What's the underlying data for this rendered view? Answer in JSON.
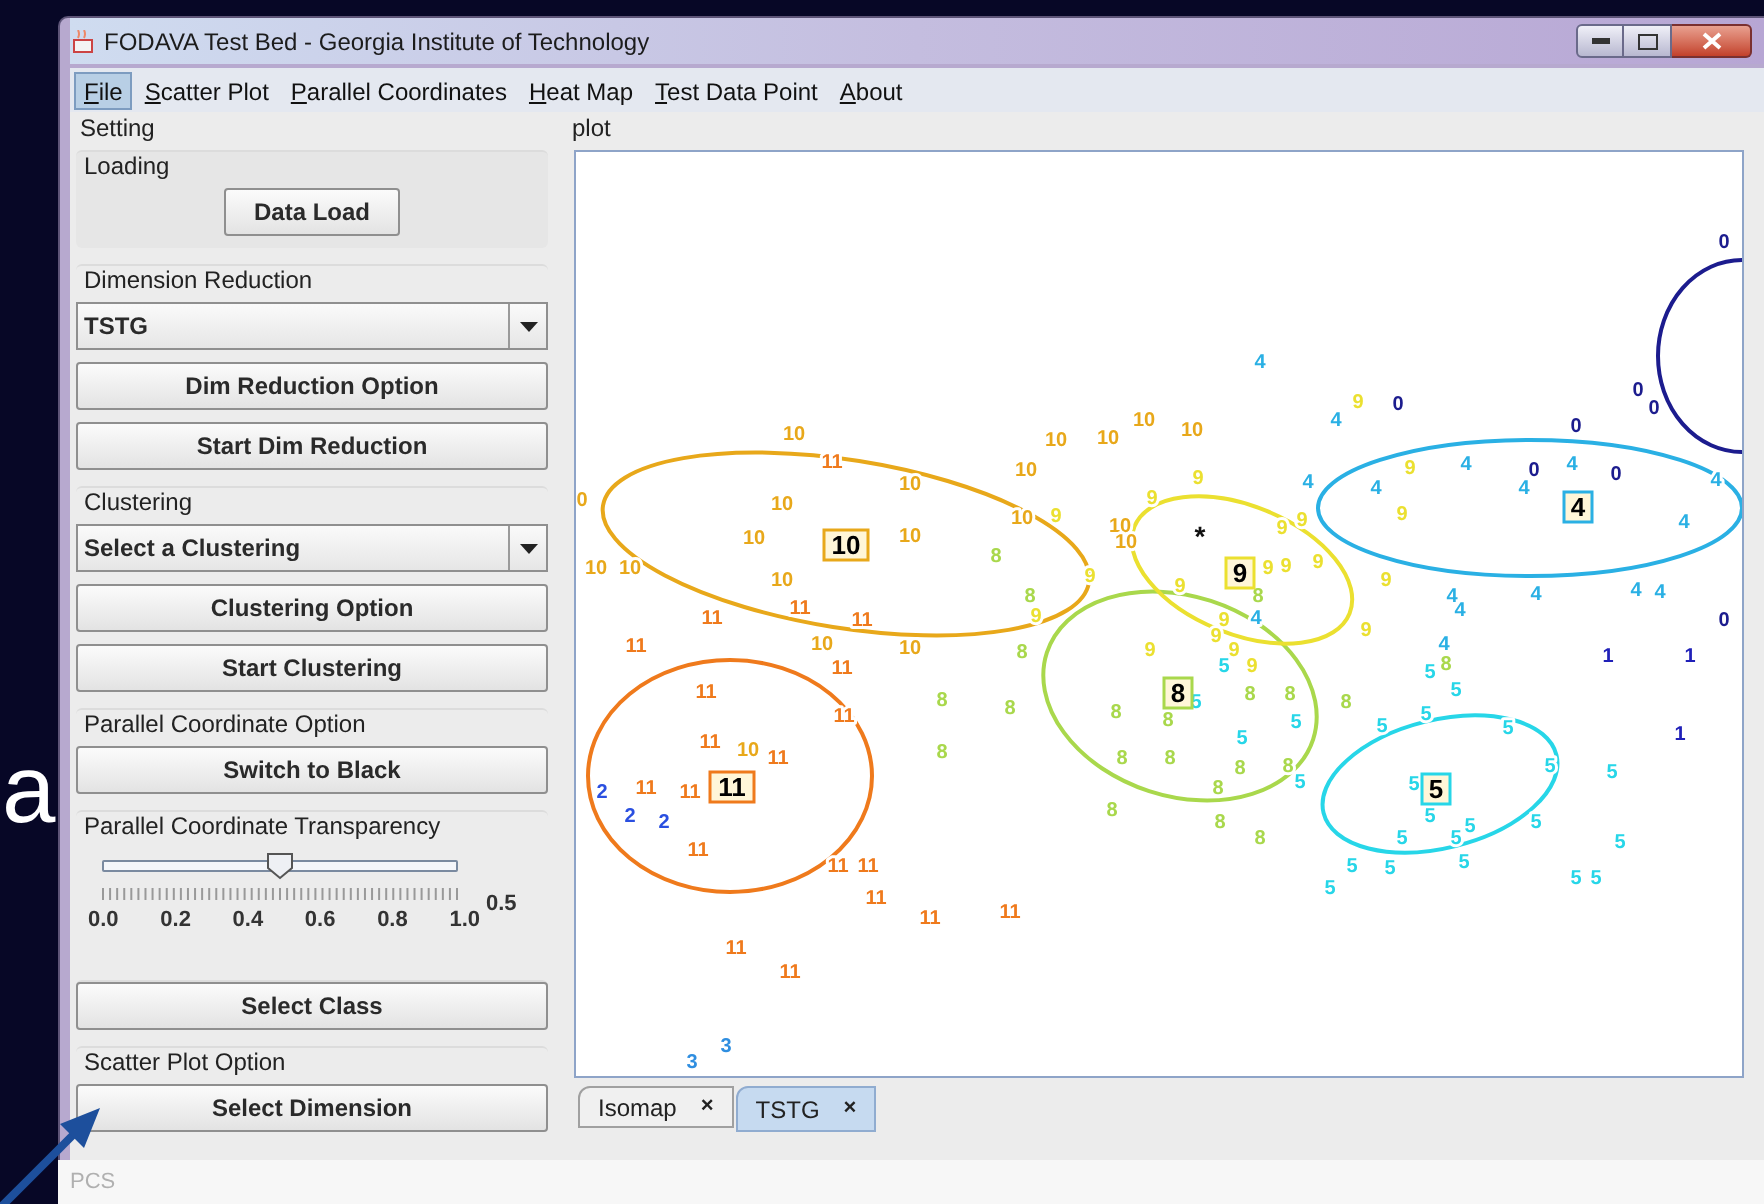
{
  "backdrop": {
    "slide_letter": "a",
    "footer_text": "PCS"
  },
  "window": {
    "title": "FODAVA Test Bed - Georgia Institute of Technology"
  },
  "menu": [
    {
      "label": "File",
      "selected": true
    },
    {
      "label": "Scatter Plot",
      "selected": false
    },
    {
      "label": "Parallel Coordinates",
      "selected": false
    },
    {
      "label": "Heat Map",
      "selected": false
    },
    {
      "label": "Test Data Point",
      "selected": false
    },
    {
      "label": "About",
      "selected": false
    }
  ],
  "settings": {
    "title": "Setting",
    "sections": [
      {
        "title": "Loading",
        "controls": [
          {
            "kind": "button",
            "label": "Data Load"
          }
        ]
      },
      {
        "title": "Dimension Reduction",
        "controls": [
          {
            "kind": "combo",
            "value": "TSTG"
          },
          {
            "kind": "button",
            "label": "Dim Reduction Option"
          },
          {
            "kind": "button",
            "label": "Start Dim Reduction"
          }
        ]
      },
      {
        "title": "Clustering",
        "controls": [
          {
            "kind": "combo",
            "value": "Select a Clustering"
          },
          {
            "kind": "button",
            "label": "Clustering Option"
          },
          {
            "kind": "button",
            "label": "Start Clustering"
          }
        ]
      },
      {
        "title": "Parallel Coordinate Option",
        "controls": [
          {
            "kind": "button",
            "label": "Switch to Black"
          }
        ]
      },
      {
        "title": "Parallel Coordinate Transparency",
        "controls": [
          {
            "kind": "slider",
            "level": 0.5,
            "reading": "0.5",
            "ticks": [
              "0.0",
              "0.2",
              "0.4",
              "0.6",
              "0.8",
              "1.0"
            ]
          }
        ]
      },
      {
        "controls": [
          {
            "kind": "button",
            "label": "Select Class"
          }
        ]
      },
      {
        "title": "Scatter Plot Option",
        "controls": [
          {
            "kind": "button",
            "label": "Select Dimension"
          }
        ]
      }
    ]
  },
  "plot": {
    "title": "plot",
    "marker": "*",
    "classes": [
      {
        "color": "#1c1c8e",
        "points": [
          "0",
          "0",
          "0",
          "0",
          "0",
          "0",
          "0",
          "0"
        ]
      },
      {
        "color": "#2020b8",
        "points": [
          "1",
          "1",
          "1"
        ]
      },
      {
        "color": "#2a4fe0",
        "points": [
          "2",
          "2",
          "2"
        ]
      },
      {
        "color": "#2f8ee0",
        "points": [
          "3",
          "3"
        ]
      },
      {
        "color": "#2ab0e4",
        "centroid": "4",
        "points": [
          "4",
          "4",
          "4",
          "4",
          "4",
          "4",
          "4",
          "4",
          "4",
          "4",
          "4",
          "4",
          "4",
          "4",
          "4",
          "4"
        ]
      },
      {
        "color": "#27d6e8",
        "centroid": "5",
        "points": [
          "5",
          "5",
          "5",
          "5",
          "5",
          "5",
          "5",
          "5",
          "5",
          "5",
          "5",
          "5",
          "5",
          "5",
          "5",
          "5",
          "5",
          "5",
          "5",
          "5",
          "5",
          "5",
          "5",
          "5",
          "5"
        ]
      },
      {
        "color": "#a9d84c",
        "centroid": "8",
        "points": [
          "8",
          "8",
          "8",
          "8",
          "8",
          "8",
          "8",
          "8",
          "8",
          "8",
          "8",
          "8",
          "8",
          "8",
          "8",
          "8",
          "8",
          "8",
          "8",
          "8",
          "8"
        ]
      },
      {
        "color": "#ebe030",
        "centroid": "9",
        "points": [
          "9",
          "9",
          "9",
          "9",
          "9",
          "9",
          "9",
          "9",
          "9",
          "9",
          "9",
          "9",
          "9",
          "9",
          "9",
          "9",
          "9",
          "9",
          "9",
          "9",
          "9"
        ]
      },
      {
        "color": "#e8a81a",
        "centroid": "10",
        "points": [
          "10",
          "10",
          "10",
          "10",
          "10",
          "10",
          "0",
          "10",
          "10",
          "10",
          "10",
          "10",
          "10",
          "10",
          "10",
          "10",
          "10",
          "10",
          "10",
          "10"
        ]
      },
      {
        "color": "#ef7a1c",
        "centroid": "11",
        "points": [
          "11",
          "11",
          "11",
          "11",
          "11",
          "11",
          "11",
          "11",
          "11",
          "11",
          "11",
          "11",
          "11",
          "11",
          "11",
          "11",
          "11",
          "11",
          "11",
          "11"
        ]
      }
    ],
    "tabs": [
      {
        "label": "Isomap",
        "close": "×",
        "selected": false
      },
      {
        "label": "TSTG",
        "close": "×",
        "selected": true
      }
    ]
  }
}
